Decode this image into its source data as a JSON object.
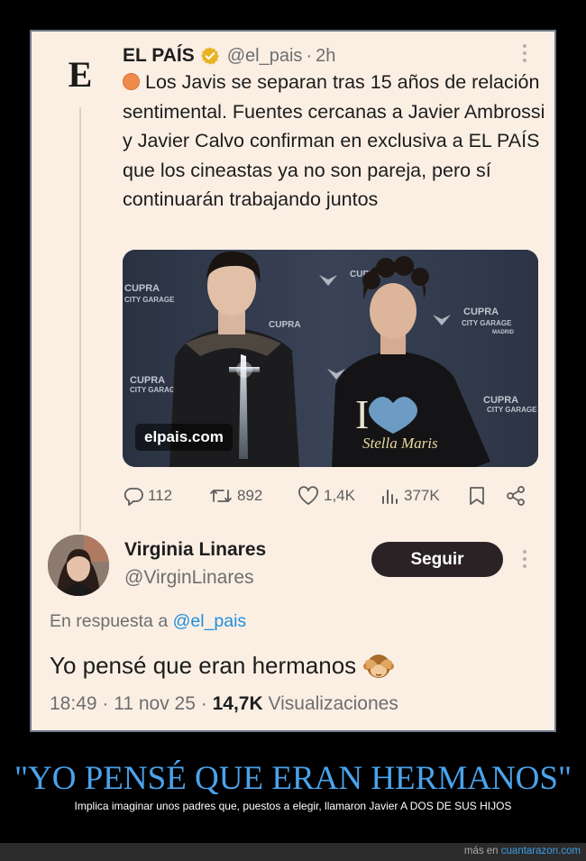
{
  "tweet": {
    "author_name": "EL PAÍS",
    "logo_letter": "E",
    "handle": "@el_pais",
    "separator": "·",
    "time": "2h",
    "text": "Los Javis se separan tras 15 años de relación sentimental. Fuentes cercanas a Javier Ambrossi y Javier Calvo confirman en exclusiva a EL PAÍS que los cineastas ya no son pareja, pero sí continuarán trabajando juntos",
    "media_domain": "elpais.com",
    "media_brand_text": [
      "CUPRA",
      "CITY GARAGE",
      "MADRID"
    ],
    "tshirt_text": "Stella Maris",
    "stats": {
      "replies": "112",
      "retweets": "892",
      "likes": "1,4K",
      "views": "377K"
    },
    "accent_color": "#f08a4b",
    "verified_color": "#e7b325"
  },
  "reply": {
    "author_name": "Virginia Linares",
    "handle": "@VirginLinares",
    "follow_label": "Seguir",
    "in_reply_prefix": "En respuesta a",
    "in_reply_handle": "@el_pais",
    "text": "Yo pensé que eran hermanos",
    "emoji": "see-no-evil-monkey",
    "time": "18:49",
    "date": "11 nov 25",
    "views_count": "14,7K",
    "views_label": "Visualizaciones"
  },
  "caption": {
    "headline": "\"YO PENSÉ QUE ERAN HERMANOS\"",
    "subline": "Implica imaginar unos padres que, puestos a elegir, llamaron Javier A DOS DE SUS HIJOS"
  },
  "footer": {
    "prefix": "más en",
    "site": "cuantarazon.com"
  },
  "colors": {
    "card_background": "#fbefe4",
    "link": "#1d8fe0",
    "headline": "#4aa3ec"
  }
}
